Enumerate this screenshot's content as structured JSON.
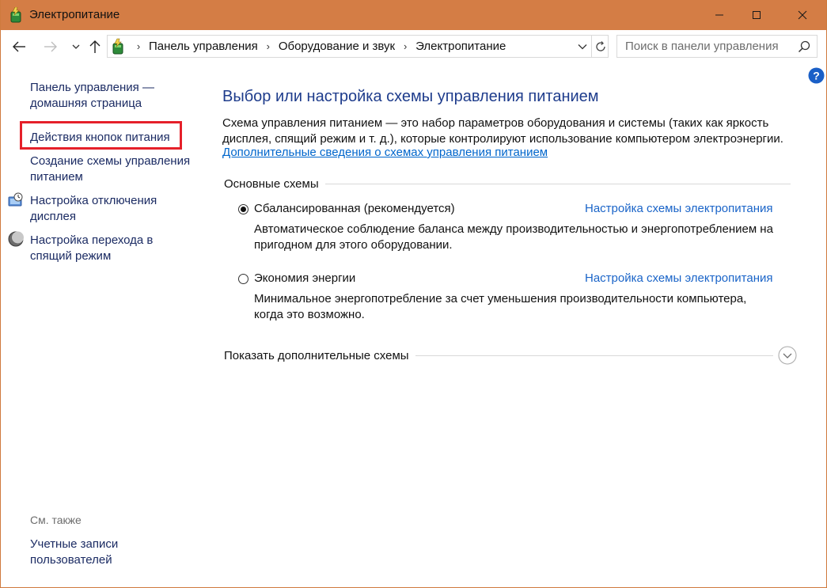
{
  "window": {
    "title": "Электропитание",
    "accent_color": "#d47d45"
  },
  "navigation": {
    "breadcrumbs": [
      "Панель управления",
      "Оборудование и звук",
      "Электропитание"
    ],
    "search_placeholder": "Поиск в панели управления"
  },
  "sidebar": {
    "home_link": "Панель управления — домашняя страница",
    "items": [
      {
        "label": "Действия кнопок питания",
        "highlighted": true
      },
      {
        "label": "Создание схемы управления питанием"
      },
      {
        "label": "Настройка отключения дисплея",
        "icon": "display-clock-icon"
      },
      {
        "label": "Настройка перехода в спящий режим",
        "icon": "moon-sleep-icon"
      }
    ],
    "see_also_label": "См. также",
    "see_also_items": [
      {
        "label": "Учетные записи пользователей"
      }
    ]
  },
  "main": {
    "title": "Выбор или настройка схемы управления питанием",
    "description": "Схема управления питанием — это набор параметров оборудования и системы (таких как яркость дисплея, спящий режим и т. д.), которые контролируют использование компьютером электроэнергии.",
    "more_info_link": "Дополнительные сведения о схемах управления питанием",
    "group_label": "Основные схемы",
    "plans": [
      {
        "name": "Сбалансированная (рекомендуется)",
        "selected": true,
        "config_link": "Настройка схемы электропитания",
        "description": "Автоматическое соблюдение баланса между производительностью и энергопотреблением на пригодном для этого оборудовании."
      },
      {
        "name": "Экономия энергии",
        "selected": false,
        "config_link": "Настройка схемы электропитания",
        "description": "Минимальное энергопотребление за счет уменьшения производительности компьютера, когда это возможно."
      }
    ],
    "show_more_label": "Показать дополнительные схемы"
  }
}
